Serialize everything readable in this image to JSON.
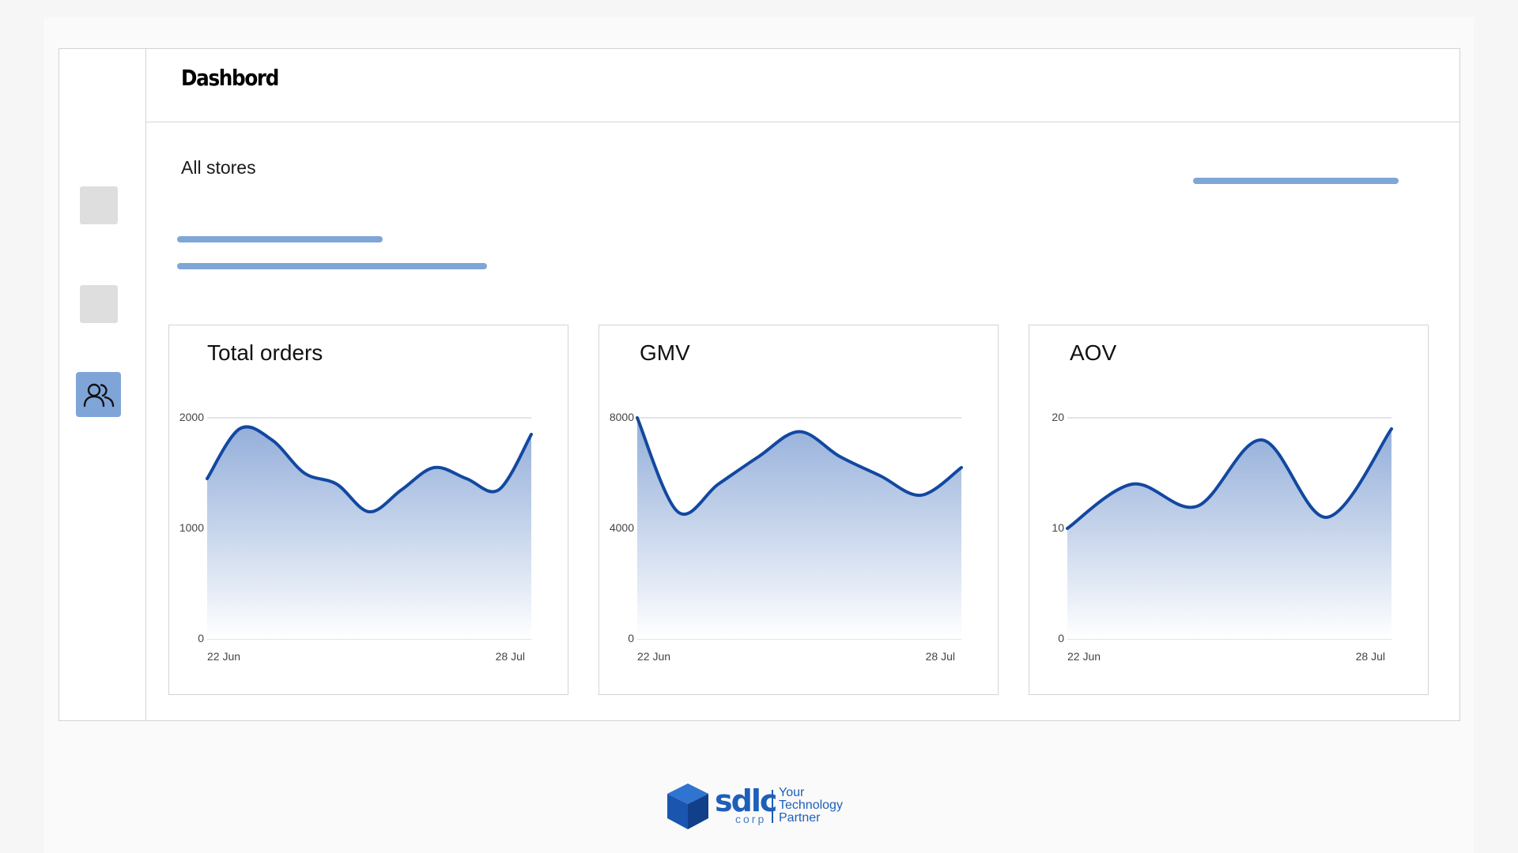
{
  "header": {
    "title": "Dashbord"
  },
  "filters": {
    "store_label": "All stores"
  },
  "colors": {
    "accent": "#7fa5d8",
    "line": "#1248a0",
    "skeleton": "#80a6d8",
    "brand": "#1e5fba"
  },
  "sidebar": {
    "items": [
      {
        "name": "placeholder",
        "icon": "blank"
      },
      {
        "name": "placeholder",
        "icon": "blank"
      },
      {
        "name": "users",
        "icon": "users-icon",
        "active": true
      }
    ]
  },
  "cards": [
    {
      "title": "Total orders"
    },
    {
      "title": "GMV"
    },
    {
      "title": "AOV"
    }
  ],
  "chart_data": [
    {
      "type": "area",
      "title": "Total orders",
      "x_start_label": "22 Jun",
      "x_end_label": "28 Jul",
      "yticks": [
        0,
        1000,
        2000
      ],
      "ylim": [
        0,
        2000
      ],
      "grid": true,
      "values": [
        1450,
        1900,
        1800,
        1500,
        1400,
        1150,
        1350,
        1550,
        1450,
        1350,
        1850
      ]
    },
    {
      "type": "area",
      "title": "GMV",
      "x_start_label": "22 Jun",
      "x_end_label": "28 Jul",
      "yticks": [
        0,
        4000,
        8000
      ],
      "ylim": [
        0,
        8000
      ],
      "grid": true,
      "values": [
        8000,
        4600,
        5600,
        6600,
        7500,
        6600,
        5900,
        5200,
        6200
      ]
    },
    {
      "type": "area",
      "title": "AOV",
      "x_start_label": "22 Jun",
      "x_end_label": "28 Jul",
      "yticks": [
        0,
        10,
        20
      ],
      "ylim": [
        0,
        20
      ],
      "grid": true,
      "values": [
        10,
        14,
        12,
        18,
        11,
        19
      ]
    }
  ],
  "logo": {
    "brand": "sdlc",
    "sub": "corp",
    "tagline": [
      "Your",
      "Technology",
      "Partner"
    ]
  }
}
